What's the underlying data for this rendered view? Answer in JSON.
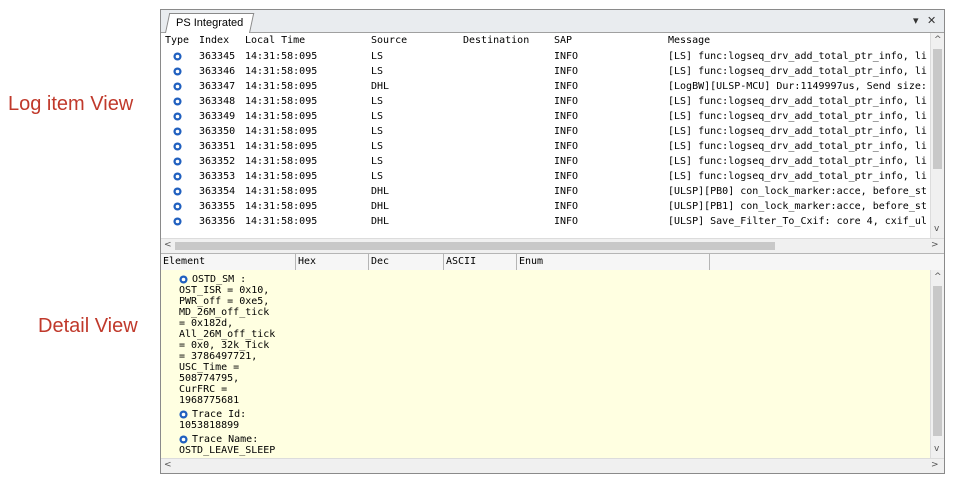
{
  "callouts": {
    "log_item_view": "Log item View",
    "detail_view": "Detail View"
  },
  "tab": {
    "title": "PS Integrated",
    "dropdown_icon": "chevron-down-icon",
    "close_icon": "close-icon"
  },
  "columns": [
    "Type",
    "Index",
    "Local Time",
    "Source",
    "Destination",
    "SAP",
    "Message"
  ],
  "rows": [
    {
      "index": "363345",
      "time": "14:31:58:095",
      "source": "LS",
      "dest": "",
      "sap": "INFO",
      "message": "[LS] func:logseq_drv_add_total_ptr_info, li"
    },
    {
      "index": "363346",
      "time": "14:31:58:095",
      "source": "LS",
      "dest": "",
      "sap": "INFO",
      "message": "[LS] func:logseq_drv_add_total_ptr_info, li"
    },
    {
      "index": "363347",
      "time": "14:31:58:095",
      "source": "DHL",
      "dest": "",
      "sap": "INFO",
      "message": "[LogBW][ULSP-MCU] Dur:1149997us, Send size:"
    },
    {
      "index": "363348",
      "time": "14:31:58:095",
      "source": "LS",
      "dest": "",
      "sap": "INFO",
      "message": "[LS] func:logseq_drv_add_total_ptr_info, li"
    },
    {
      "index": "363349",
      "time": "14:31:58:095",
      "source": "LS",
      "dest": "",
      "sap": "INFO",
      "message": "[LS] func:logseq_drv_add_total_ptr_info, li"
    },
    {
      "index": "363350",
      "time": "14:31:58:095",
      "source": "LS",
      "dest": "",
      "sap": "INFO",
      "message": "[LS] func:logseq_drv_add_total_ptr_info, li"
    },
    {
      "index": "363351",
      "time": "14:31:58:095",
      "source": "LS",
      "dest": "",
      "sap": "INFO",
      "message": "[LS] func:logseq_drv_add_total_ptr_info, li"
    },
    {
      "index": "363352",
      "time": "14:31:58:095",
      "source": "LS",
      "dest": "",
      "sap": "INFO",
      "message": "[LS] func:logseq_drv_add_total_ptr_info, li"
    },
    {
      "index": "363353",
      "time": "14:31:58:095",
      "source": "LS",
      "dest": "",
      "sap": "INFO",
      "message": "[LS] func:logseq_drv_add_total_ptr_info, li"
    },
    {
      "index": "363354",
      "time": "14:31:58:095",
      "source": "DHL",
      "dest": "",
      "sap": "INFO",
      "message": "[ULSP][PB0] con_lock_marker:acce, before_st"
    },
    {
      "index": "363355",
      "time": "14:31:58:095",
      "source": "DHL",
      "dest": "",
      "sap": "INFO",
      "message": "[ULSP][PB1] con_lock_marker:acce, before_st"
    },
    {
      "index": "363356",
      "time": "14:31:58:095",
      "source": "DHL",
      "dest": "",
      "sap": "INFO",
      "message": "[ULSP] Save_Filter_To_Cxif: core 4, cxif_ul"
    }
  ],
  "detail_columns": [
    "Element",
    "Hex",
    "Dec",
    "ASCII",
    "Enum"
  ],
  "detail_lines": [
    {
      "text": "OSTD_SM :",
      "icon": true
    },
    {
      "text": "OST_ISR = 0x10,"
    },
    {
      "text": "PWR_off = 0xe5,"
    },
    {
      "text": "MD_26M_off_tick"
    },
    {
      "text": "= 0x182d,"
    },
    {
      "text": "All_26M_off_tick"
    },
    {
      "text": "= 0x0, 32k_Tick"
    },
    {
      "text": "= 3786497721,"
    },
    {
      "text": "USC_Time ="
    },
    {
      "text": "508774795,"
    },
    {
      "text": "CurFRC ="
    },
    {
      "text": "1968775681"
    },
    {
      "text": "Trace Id:",
      "icon": true
    },
    {
      "text": "1053818899"
    },
    {
      "text": "Trace Name:",
      "icon": true
    },
    {
      "text": "OSTD_LEAVE_SLEEP"
    }
  ],
  "colors": {
    "detail_bg": "#ffffe1",
    "icon_blue": "#1f5fbf",
    "callout_red": "#c0392b"
  }
}
